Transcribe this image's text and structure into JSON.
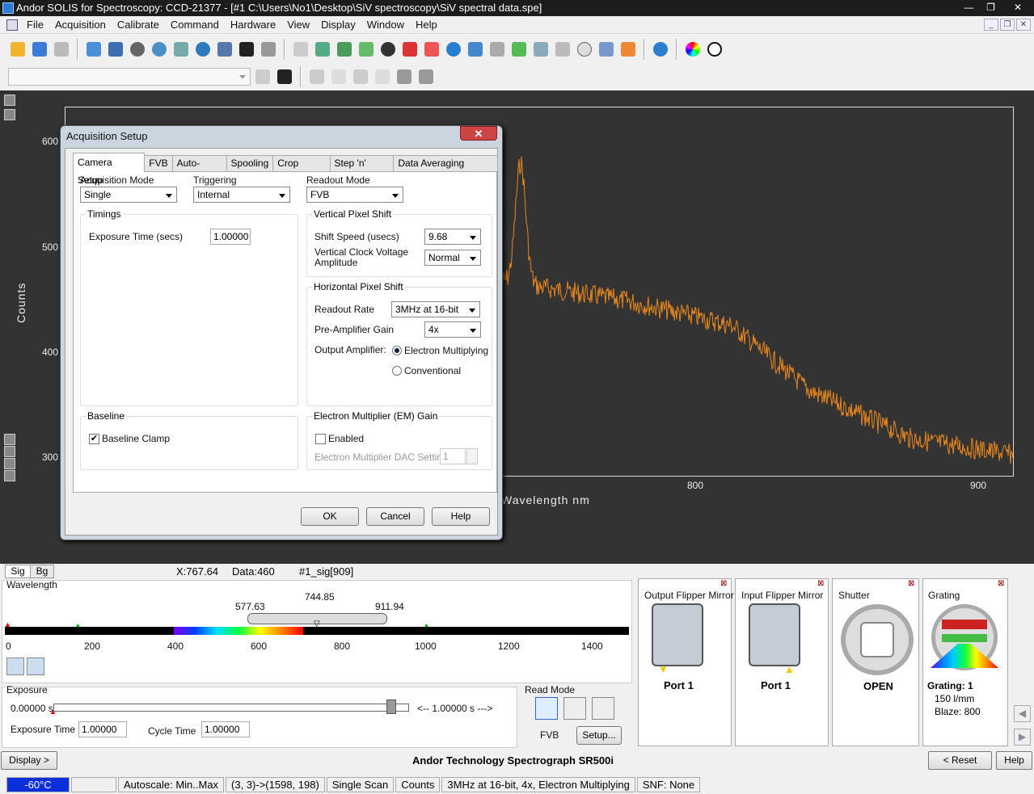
{
  "window": {
    "title": "Andor SOLIS for Spectroscopy: CCD-21377 - [#1   C:\\Users\\No1\\Desktop\\SiV spectroscopy\\SiV spectral data.spe]",
    "minimize": "—",
    "restore": "❐",
    "close": "✕"
  },
  "menu": [
    "File",
    "Acquisition",
    "Calibrate",
    "Command",
    "Hardware",
    "View",
    "Display",
    "Window",
    "Help"
  ],
  "plot": {
    "ylabel": "Counts",
    "xlabel": "Wavelength nm",
    "yticks": [
      "600",
      "500",
      "400",
      "300"
    ],
    "xticks": [
      "800",
      "900"
    ],
    "trace_color": "#e8871e"
  },
  "dialog": {
    "title": "Acquisition Setup",
    "close": "✕",
    "tabs": [
      "Camera Setup",
      "FVB",
      "Auto-Save",
      "Spooling",
      "Crop Mode",
      "Step 'n' Glue",
      "Data Averaging Filters"
    ],
    "acq_mode_label": "Acquisition Mode",
    "acq_mode": "Single",
    "trigger_label": "Triggering",
    "trigger": "Internal",
    "readout_label": "Readout Mode",
    "readout": "FVB",
    "timings": "Timings",
    "exposure_label": "Exposure Time (secs)",
    "exposure": "1.00000",
    "vps": "Vertical Pixel Shift",
    "shift_speed_label": "Shift Speed (usecs)",
    "shift_speed": "9.68",
    "vclock_label": "Vertical Clock Voltage Amplitude",
    "vclock": "Normal",
    "hps": "Horizontal Pixel Shift",
    "readout_rate_label": "Readout Rate",
    "readout_rate": "3MHz at 16-bit",
    "preamp_label": "Pre-Amplifier Gain",
    "preamp": "4x",
    "outamp_label": "Output Amplifier:",
    "em_opt": "Electron Multiplying",
    "conv_opt": "Conventional",
    "baseline": "Baseline",
    "baseline_clamp": "Baseline Clamp",
    "em_gain": "Electron Multiplier (EM) Gain",
    "em_enabled": "Enabled",
    "em_dac_label": "Electron Multiplier DAC Setting",
    "em_dac": "1",
    "ok": "OK",
    "cancel": "Cancel",
    "help": "Help"
  },
  "status_line": {
    "tab_sig": "Sig",
    "tab_bg": "Bg",
    "x": "X:767.64",
    "data": "Data:460",
    "sig": "#1_sig[909]"
  },
  "wavelength": {
    "label": "Wavelength",
    "center": "744.85",
    "low": "577.63",
    "high": "911.94",
    "ticks": [
      "0",
      "200",
      "400",
      "600",
      "800",
      "1000",
      "1200",
      "1400"
    ]
  },
  "exposure": {
    "label": "Exposure",
    "start": "0.00000 s",
    "range": "<-- 1.00000 s --->",
    "time_label": "Exposure Time",
    "time": "1.00000",
    "cycle_label": "Cycle Time",
    "cycle": "1.00000"
  },
  "readmode": {
    "label": "Read Mode",
    "mode": "FVB",
    "setup": "Setup..."
  },
  "panels": {
    "out_mirror": {
      "title": "Output Flipper Mirror",
      "port": "Port 1"
    },
    "in_mirror": {
      "title": "Input Flipper Mirror",
      "port": "Port 1"
    },
    "shutter": {
      "title": "Shutter",
      "state": "OPEN"
    },
    "grating": {
      "title": "Grating",
      "grating": "Grating: 1",
      "lines": "150 l/mm",
      "blaze": "Blaze: 800"
    }
  },
  "footer": {
    "display": "Display >",
    "spectrograph": "Andor Technology Spectrograph SR500i",
    "reset": "< Reset",
    "help": "Help"
  },
  "statusbar": {
    "temp": "-60°C",
    "autoscale": "Autoscale: Min..Max",
    "coords": "(3, 3)->(1598, 198)",
    "scan": "Single Scan",
    "units": "Counts",
    "mode": "3MHz at 16-bit, 4x, Electron Multiplying",
    "snf": "SNF: None"
  }
}
